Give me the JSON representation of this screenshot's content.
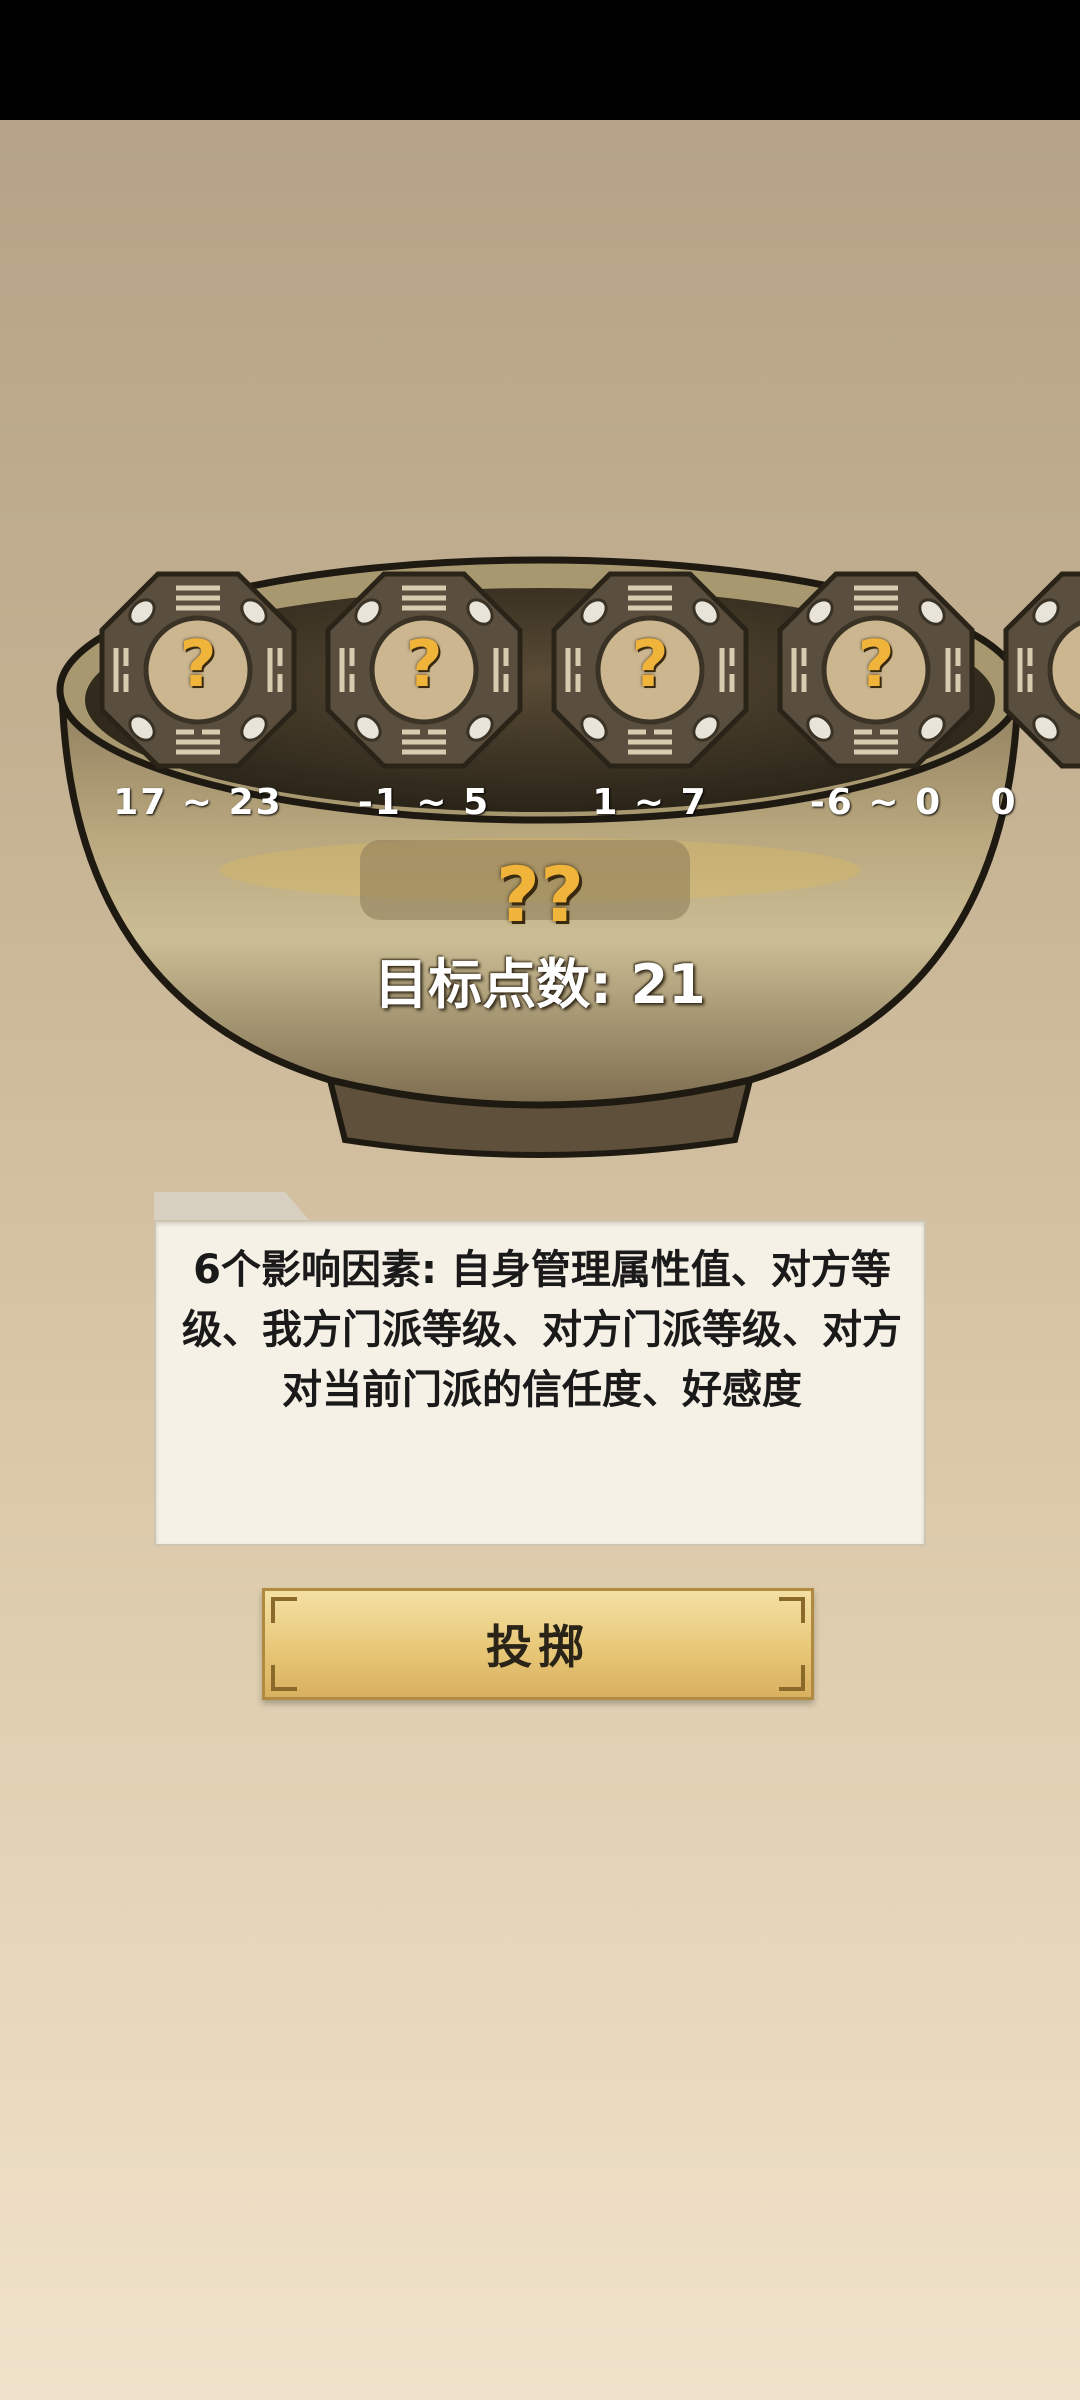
{
  "dice": [
    {
      "face": "?",
      "range": "17 ~ 23"
    },
    {
      "face": "?",
      "range": "-1 ~ 5"
    },
    {
      "face": "?",
      "range": "1 ~ 7"
    },
    {
      "face": "?",
      "range": "-6 ~ 0"
    },
    {
      "face": "?",
      "range": "0"
    }
  ],
  "result": {
    "value": "??"
  },
  "target": {
    "label": "目标点数: 21"
  },
  "note": {
    "text": "6个影响因素: 自身管理属性值、对方等级、我方门派等级、对方门派等级、对方对当前门派的信任度、好感度"
  },
  "throw_button": {
    "label": "投掷"
  },
  "colors": {
    "gold": "#f0b43a",
    "button": "#e8c878",
    "note_bg": "#f6f1e6",
    "bowl": "#6a5a3e"
  }
}
